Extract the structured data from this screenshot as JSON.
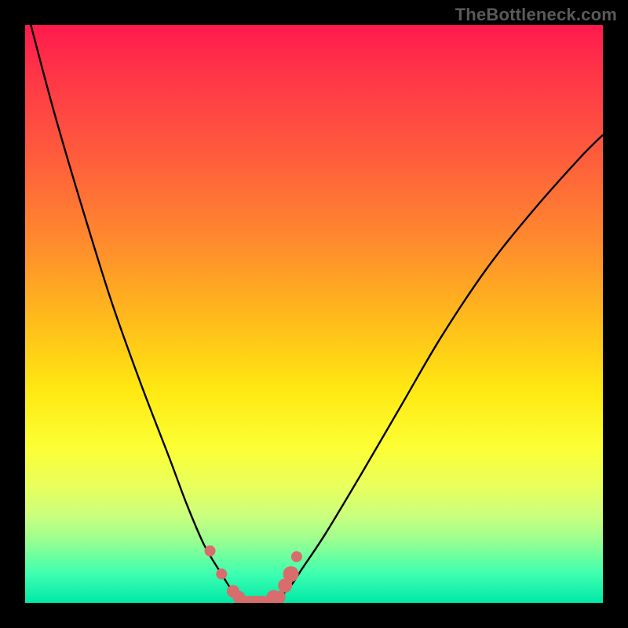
{
  "watermark": "TheBottleneck.com",
  "colors": {
    "frame_bg": "#000000",
    "curve_stroke": "#000000",
    "marker_fill": "#d96c6c",
    "gradient_top": "#ff1a4d",
    "gradient_bottom": "#00e8a8"
  },
  "chart_data": {
    "type": "line",
    "title": "",
    "xlabel": "",
    "ylabel": "",
    "xlim": [
      0,
      100
    ],
    "ylim": [
      0,
      100
    ],
    "grid": false,
    "legend": false,
    "note": "No axis ticks or numeric labels are rendered in the image; x/y ranges are normalized 0–100. Y-axis appears inverted visually (0 at bottom = green = good / low bottleneck; 100 at top = red = high bottleneck). Curve is a V-shape with minimum near x≈40.",
    "series": [
      {
        "name": "bottleneck-curve",
        "x": [
          1,
          5,
          10,
          15,
          20,
          25,
          28,
          31,
          34,
          36,
          38,
          40,
          42,
          44,
          46,
          48,
          52,
          58,
          65,
          72,
          80,
          88,
          96,
          100
        ],
        "values": [
          100,
          85,
          68,
          52,
          38,
          25,
          17,
          10,
          5,
          2,
          1,
          0,
          0,
          1,
          3,
          6,
          12,
          22,
          34,
          46,
          58,
          68,
          77,
          81
        ]
      }
    ],
    "markers": {
      "name": "highlighted-points",
      "x": [
        32,
        34,
        36,
        37,
        38,
        39,
        40,
        41,
        42,
        43,
        44,
        45,
        46,
        47
      ],
      "values": [
        9,
        5,
        2,
        1,
        0,
        0,
        0,
        0,
        0,
        1,
        1,
        3,
        5,
        8
      ],
      "size": [
        7,
        7,
        8,
        8,
        9,
        9,
        9,
        9,
        9,
        9,
        8,
        9,
        10,
        7
      ]
    }
  }
}
